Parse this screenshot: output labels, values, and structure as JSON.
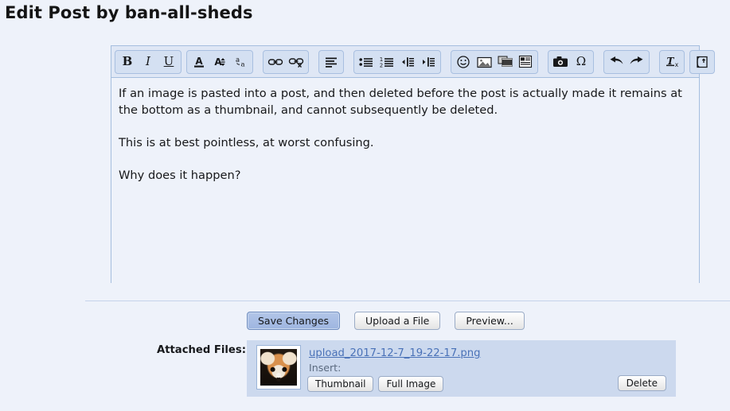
{
  "page": {
    "title": "Edit Post by ban-all-sheds"
  },
  "editor": {
    "toolbar": {
      "groups": [
        {
          "name": "text-style",
          "buttons": [
            {
              "name": "bold-button",
              "icon": "bold-icon",
              "label": "B"
            },
            {
              "name": "italic-button",
              "icon": "italic-icon",
              "label": "I"
            },
            {
              "name": "underline-button",
              "icon": "underline-icon",
              "label": "U"
            }
          ]
        },
        {
          "name": "font-options",
          "buttons": [
            {
              "name": "text-color-button",
              "icon": "text-color-icon",
              "label": "A"
            },
            {
              "name": "font-size-button",
              "icon": "font-size-icon",
              "label": "A"
            },
            {
              "name": "font-family-button",
              "icon": "font-family-icon",
              "label": "a"
            }
          ]
        },
        {
          "name": "link-tools",
          "buttons": [
            {
              "name": "insert-link-button",
              "icon": "link-icon",
              "label": ""
            },
            {
              "name": "remove-link-button",
              "icon": "unlink-icon",
              "label": ""
            }
          ]
        },
        {
          "name": "alignment",
          "buttons": [
            {
              "name": "align-button",
              "icon": "align-left-icon",
              "label": ""
            }
          ]
        },
        {
          "name": "lists-indent",
          "buttons": [
            {
              "name": "bullet-list-button",
              "icon": "bullet-list-icon",
              "label": ""
            },
            {
              "name": "numbered-list-button",
              "icon": "numbered-list-icon",
              "label": ""
            },
            {
              "name": "outdent-button",
              "icon": "outdent-icon",
              "label": ""
            },
            {
              "name": "indent-button",
              "icon": "indent-icon",
              "label": ""
            }
          ]
        },
        {
          "name": "media-insert",
          "buttons": [
            {
              "name": "emoji-button",
              "icon": "smiley-icon",
              "label": ""
            },
            {
              "name": "insert-image-button",
              "icon": "image-icon",
              "label": ""
            },
            {
              "name": "insert-media-button",
              "icon": "film-icon",
              "label": ""
            },
            {
              "name": "insert-quote-button",
              "icon": "quote-block-icon",
              "label": ""
            }
          ]
        },
        {
          "name": "capture-symbol",
          "buttons": [
            {
              "name": "screenshot-button",
              "icon": "camera-icon",
              "label": ""
            },
            {
              "name": "special-character-button",
              "icon": "omega-icon",
              "label": "Ω"
            }
          ]
        },
        {
          "name": "history",
          "buttons": [
            {
              "name": "undo-button",
              "icon": "undo-arrow-icon",
              "label": ""
            },
            {
              "name": "redo-button",
              "icon": "redo-arrow-icon",
              "label": ""
            }
          ]
        },
        {
          "name": "remove-formatting",
          "buttons": [
            {
              "name": "remove-formatting-button",
              "icon": "clear-format-icon",
              "label": "T"
            }
          ]
        },
        {
          "name": "source-toggle",
          "buttons": [
            {
              "name": "toggle-bbcode-button",
              "icon": "bbcode-toggle-icon",
              "label": ""
            }
          ]
        }
      ]
    },
    "content": {
      "paragraphs": [
        "If an image is pasted into a post, and then deleted before the post is actually made it remains at the bottom as a thumbnail, and cannot subsequently be deleted.",
        "This is at best pointless, at worst confusing.",
        "Why does it happen?"
      ]
    }
  },
  "actions": {
    "save_label": "Save Changes",
    "upload_label": "Upload a File",
    "preview_label": "Preview..."
  },
  "attachments": {
    "section_label": "Attached Files:",
    "items": [
      {
        "filename": "upload_2017-12-7_19-22-17.png",
        "insert_label": "Insert:",
        "thumbnail_label": "Thumbnail",
        "full_image_label": "Full Image",
        "delete_label": "Delete",
        "thumbnail_alt": "red-panda-thumbnail"
      }
    ]
  },
  "colors": {
    "page_background": "#eef2fa",
    "toolbar_background": "#dfe7f5",
    "editor_border": "#a5bede",
    "primary_button": "#9eb5e0",
    "attachment_panel": "#ccd9ee",
    "link_text": "#4a72b8"
  }
}
